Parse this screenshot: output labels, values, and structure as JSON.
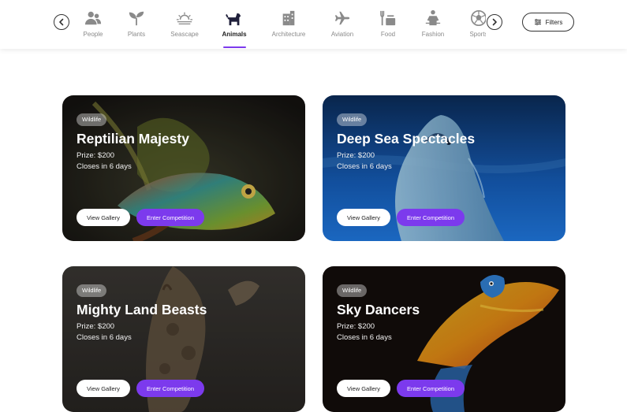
{
  "nav": {
    "categories": [
      {
        "label": "People",
        "icon": "people-icon"
      },
      {
        "label": "Plants",
        "icon": "plant-icon"
      },
      {
        "label": "Seascape",
        "icon": "sunset-icon"
      },
      {
        "label": "Animals",
        "icon": "dog-icon",
        "active": true
      },
      {
        "label": "Architecture",
        "icon": "building-icon"
      },
      {
        "label": "Aviation",
        "icon": "airplane-icon"
      },
      {
        "label": "Food",
        "icon": "food-icon"
      },
      {
        "label": "Fashion",
        "icon": "fashion-icon"
      },
      {
        "label": "Sports",
        "icon": "soccer-ball-icon"
      }
    ],
    "filters_label": "Filters",
    "accent_color": "#7c3aed"
  },
  "cards": [
    {
      "badge": "Wildlife",
      "title": "Reptilian Majesty",
      "prize": "Prize: $200",
      "closes": "Closes in 6 days",
      "gallery_label": "View Gallery",
      "enter_label": "Enter Competition"
    },
    {
      "badge": "Wildlife",
      "title": "Deep Sea Spectacles",
      "prize": "Prize: $200",
      "closes": "Closes in 6 days",
      "gallery_label": "View Gallery",
      "enter_label": "Enter Competition"
    },
    {
      "badge": "Wildlife",
      "title": "Mighty Land Beasts",
      "prize": "Prize: $200",
      "closes": "Closes in 6 days",
      "gallery_label": "View Gallery",
      "enter_label": "Enter Competition"
    },
    {
      "badge": "Wildlife",
      "title": "Sky Dancers",
      "prize": "Prize: $200",
      "closes": "Closes in 6 days",
      "gallery_label": "View Gallery",
      "enter_label": "Enter Competition"
    }
  ]
}
